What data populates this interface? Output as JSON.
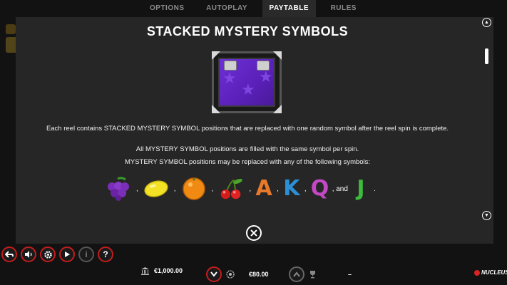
{
  "tabs": [
    {
      "label": "OPTIONS",
      "active": false
    },
    {
      "label": "AUTOPLAY",
      "active": false
    },
    {
      "label": "PAYTABLE",
      "active": true
    },
    {
      "label": "RULES",
      "active": false
    }
  ],
  "section": {
    "title": "STACKED MYSTERY SYMBOLS",
    "paragraph1": "Each reel contains STACKED MYSTERY SYMBOL positions that are replaced with one random symbol after the reel spin is complete.",
    "paragraph2": "All MYSTERY SYMBOL positions are filled with the same symbol per spin.",
    "paragraph3": "MYSTERY SYMBOL positions may be replaced with any of the following symbols:"
  },
  "symbols": {
    "separator": ",",
    "and_text": ", and",
    "end": ".",
    "letters": [
      {
        "char": "A",
        "color": "#e8792a"
      },
      {
        "char": "K",
        "color": "#2b8fd6"
      },
      {
        "char": "Q",
        "color": "#c447c4"
      },
      {
        "char": "J",
        "color": "#3dbb3d"
      }
    ]
  },
  "footer": {
    "balance": "€1,000.00",
    "bet": "€80.00",
    "win": "–",
    "brand": "NUCLEUS"
  },
  "colors": {
    "accent_red": "#c21d1d",
    "panel_bg": "#262626"
  }
}
